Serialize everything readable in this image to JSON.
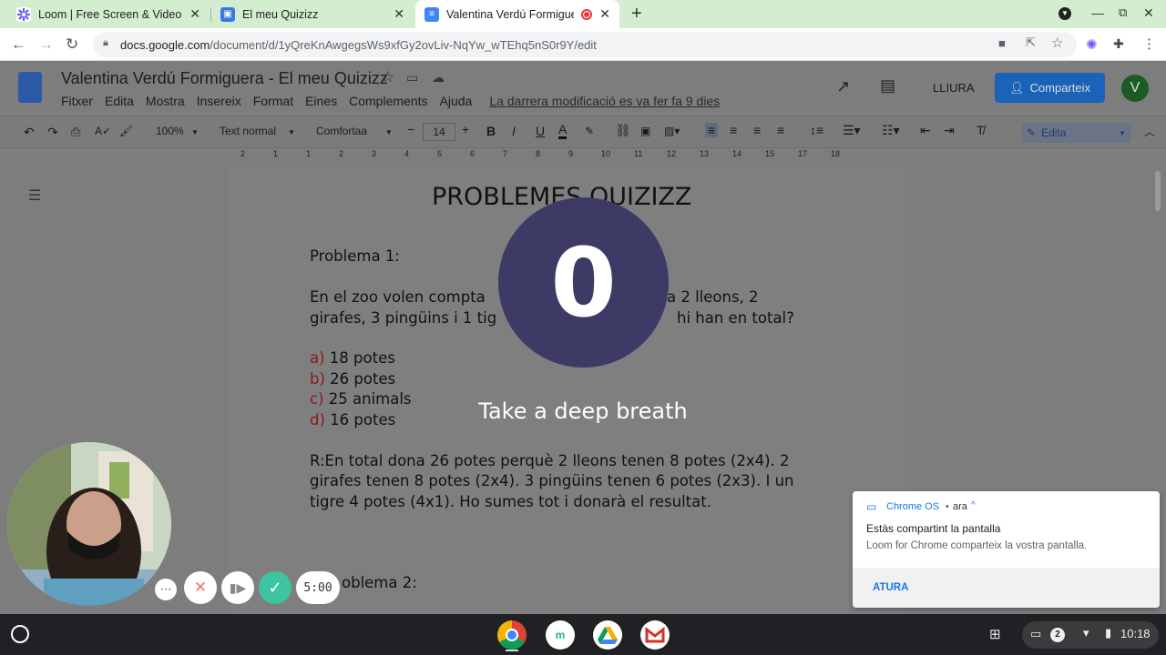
{
  "tabs": [
    {
      "title": "Loom | Free Screen & Video Reco",
      "icon": "loom-icon"
    },
    {
      "title": "El meu Quizizz",
      "icon": "classroom-icon"
    },
    {
      "title": "Valentina Verdú Formiguera",
      "icon": "docs-icon",
      "recording": true
    }
  ],
  "address": {
    "host": "docs.google.com",
    "path": "/document/d/1yQreKnAwgegsWs9xfGy2ovLiv-NqYw_wTEhq5nS0r9Y/edit"
  },
  "doc": {
    "title": "Valentina Verdú Formiguera - El meu Quizizz",
    "menu": [
      "Fitxer",
      "Edita",
      "Mostra",
      "Insereix",
      "Format",
      "Eines",
      "Complements",
      "Ajuda"
    ],
    "last_edit": "La darrera modificació es va fer fa 9 dies",
    "mode_label": "LLIURA",
    "share_label": "Comparteix",
    "avatar_letter": "V",
    "zoom": "100%",
    "style": "Text normal",
    "font": "Comfortaa",
    "font_size": "14",
    "edit_mode": "Edita",
    "ruler": [
      "2",
      "1",
      "1",
      "2",
      "3",
      "4",
      "5",
      "6",
      "7",
      "8",
      "9",
      "10",
      "11",
      "12",
      "13",
      "14",
      "15",
      "17",
      "18"
    ],
    "heading": "PROBLEMES QUIZIZZ",
    "problem1_label": "Problema 1:",
    "problem1_line1": "En el zoo volen compta",
    "problem1_line1b": "a 2 lleons, 2",
    "problem1_line2": "girafes, 3 pingüins i 1 tig",
    "problem1_line2b": "hi han en total?",
    "options": [
      {
        "letter": "a)",
        "text": " 18 potes"
      },
      {
        "letter": "b)",
        "text": " 26 potes"
      },
      {
        "letter": "c)",
        "text": " 25 animals"
      },
      {
        "letter": "d)",
        "text": " 16 potes"
      }
    ],
    "answer_lines": [
      "R:En total dona 26 potes perquè 2 lleons tenen 8 potes (2x4). 2",
      "girafes tenen 8 potes (2x4). 3 pingüins tenen 6 potes (2x3). I un",
      "tigre 4 potes (4x1). Ho sumes tot i donarà el resultat."
    ],
    "problem2_label": "oblema 2:"
  },
  "overlay": {
    "countdown": "0",
    "message": "Take a deep breath",
    "timer": "5:00"
  },
  "notification": {
    "source": "Chrome OS",
    "time": "ara",
    "title": "Estàs compartint la pantalla",
    "body": "Loom for Chrome comparteix la vostra pantalla.",
    "action": "ATURA"
  },
  "shelf": {
    "clock": "10:18",
    "badge": "2"
  },
  "colors": {
    "share_button": "#1a63b8",
    "countdown_bg": "#3e3a66",
    "confirm": "#3dc4a0",
    "tabstrip": "#d4ecd0"
  }
}
